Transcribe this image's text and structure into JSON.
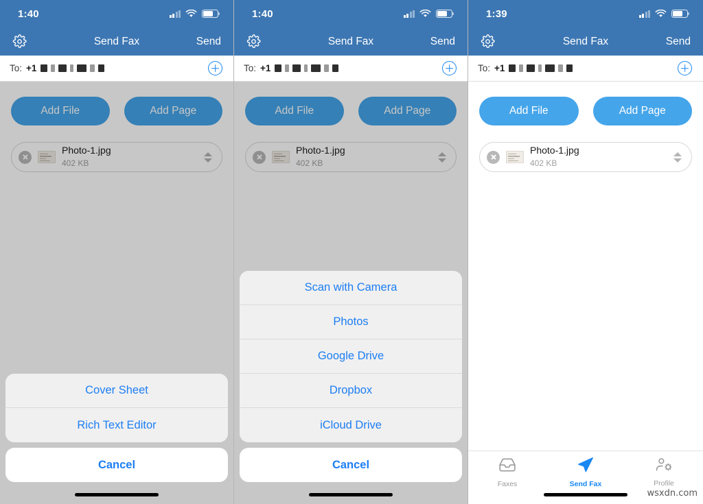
{
  "brand": {
    "navbar_blue": "#3d77b3",
    "button_blue": "#45a5ea",
    "action_blue": "#1d7ef3",
    "tab_active_blue": "#1887f2"
  },
  "watermark": "wsxdn.com",
  "panels": [
    {
      "id": "panel-cover-sheet-sheet",
      "status": {
        "time": "1:40"
      },
      "navbar": {
        "title": "Send Fax",
        "send_label": "Send",
        "settings_icon": "gear-icon"
      },
      "to_field": {
        "label": "To:",
        "country_code": "+1",
        "number_redacted": true,
        "add_icon": "plus-circle-icon"
      },
      "buttons": {
        "add_file": "Add File",
        "add_page": "Add Page"
      },
      "file": {
        "name": "Photo-1.jpg",
        "size": "402 KB",
        "remove_icon": "close-circle-icon",
        "reorder_icon": "stepper-icon"
      },
      "dimmed": true,
      "action_sheet": {
        "items": [
          "Cover Sheet",
          "Rich Text Editor"
        ],
        "cancel": "Cancel"
      },
      "tabbar_visible": false
    },
    {
      "id": "panel-add-file-sheet",
      "status": {
        "time": "1:40"
      },
      "navbar": {
        "title": "Send Fax",
        "send_label": "Send",
        "settings_icon": "gear-icon"
      },
      "to_field": {
        "label": "To:",
        "country_code": "+1",
        "number_redacted": true,
        "add_icon": "plus-circle-icon"
      },
      "buttons": {
        "add_file": "Add File",
        "add_page": "Add Page"
      },
      "file": {
        "name": "Photo-1.jpg",
        "size": "402 KB",
        "remove_icon": "close-circle-icon",
        "reorder_icon": "stepper-icon"
      },
      "dimmed": true,
      "action_sheet": {
        "items": [
          "Scan with Camera",
          "Photos",
          "Google Drive",
          "Dropbox",
          "iCloud Drive"
        ],
        "cancel": "Cancel"
      },
      "tabbar_visible": false
    },
    {
      "id": "panel-compose",
      "status": {
        "time": "1:39"
      },
      "navbar": {
        "title": "Send Fax",
        "send_label": "Send",
        "settings_icon": "gear-icon"
      },
      "to_field": {
        "label": "To:",
        "country_code": "+1",
        "number_redacted": true,
        "add_icon": "plus-circle-icon"
      },
      "buttons": {
        "add_file": "Add File",
        "add_page": "Add Page"
      },
      "file": {
        "name": "Photo-1.jpg",
        "size": "402 KB",
        "remove_icon": "close-circle-icon",
        "reorder_icon": "stepper-icon"
      },
      "dimmed": false,
      "action_sheet": null,
      "tabbar_visible": true,
      "tabbar": {
        "tabs": [
          {
            "label": "Faxes",
            "icon": "inbox-tray-icon",
            "active": false
          },
          {
            "label": "Send Fax",
            "icon": "paper-plane-icon",
            "active": true
          },
          {
            "label": "Profile",
            "icon": "person-gear-icon",
            "active": false
          }
        ]
      }
    }
  ]
}
